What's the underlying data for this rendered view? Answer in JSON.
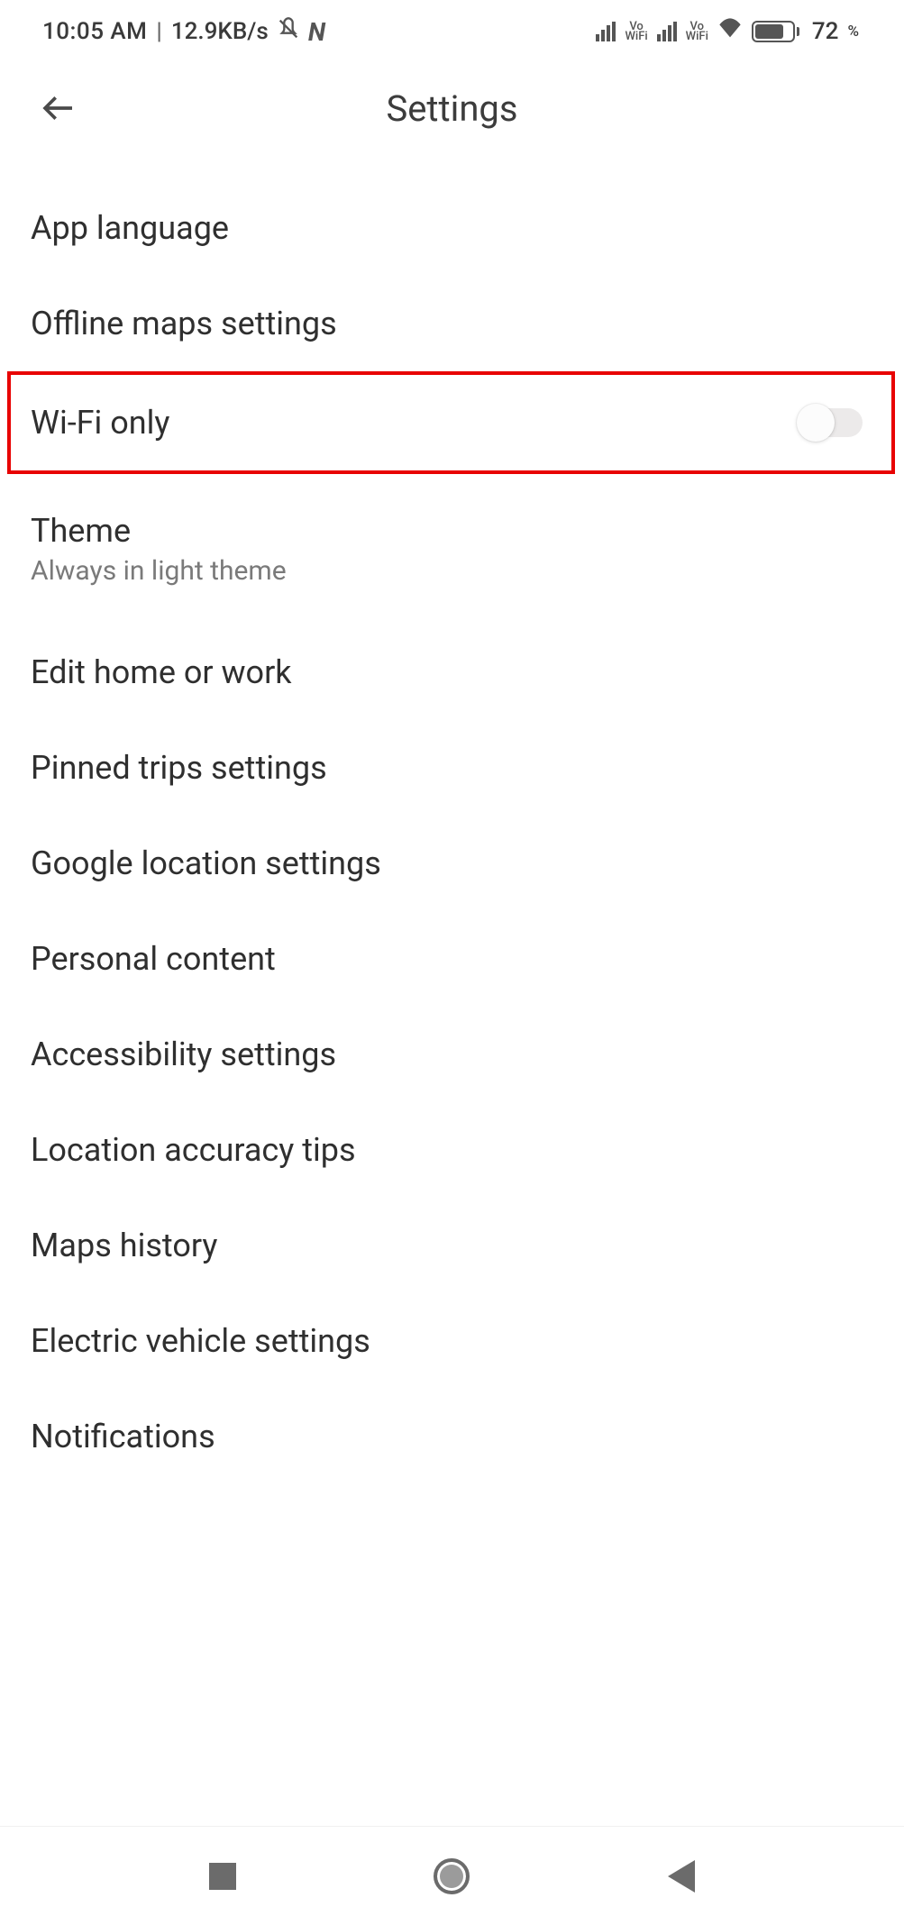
{
  "status": {
    "time": "10:05 AM",
    "data_rate": "12.9KB/s",
    "battery_pct": "72",
    "battery_sym": "%",
    "vo_wifi": "Vo\nWiFi"
  },
  "header": {
    "title": "Settings"
  },
  "items": {
    "app_language": "App language",
    "offline_maps": "Offline maps settings",
    "wifi_only": "Wi-Fi only",
    "theme": "Theme",
    "theme_sub": "Always in light theme",
    "edit_home": "Edit home or work",
    "pinned_trips": "Pinned trips settings",
    "google_location": "Google location settings",
    "personal_content": "Personal content",
    "accessibility": "Accessibility settings",
    "location_accuracy": "Location accuracy tips",
    "maps_history": "Maps history",
    "ev_settings": "Electric vehicle settings",
    "notifications": "Notifications"
  }
}
